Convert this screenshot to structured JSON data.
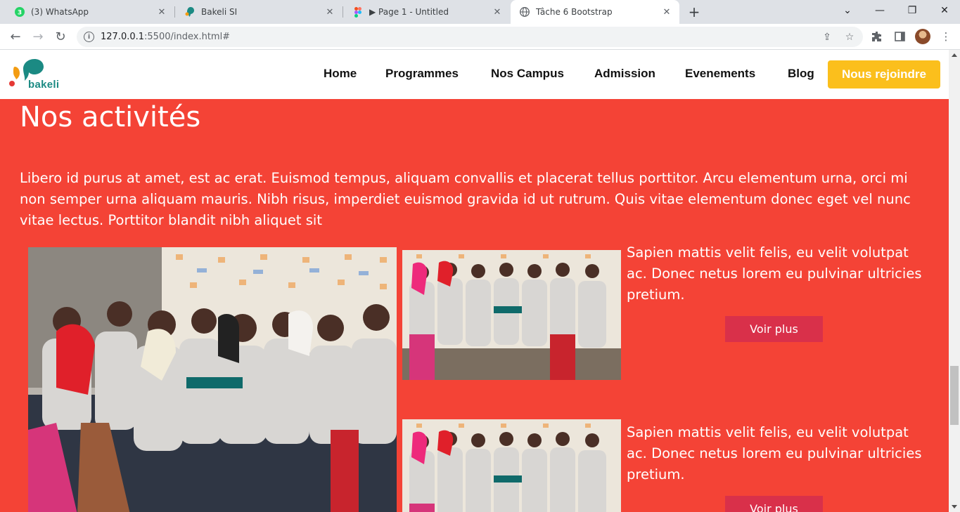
{
  "browser": {
    "tabs": [
      {
        "title": "(3) WhatsApp",
        "icon": "whatsapp-icon",
        "badge": "3"
      },
      {
        "title": "Bakeli SI",
        "icon": "bakeli-icon"
      },
      {
        "title": "▶ Page 1 - Untitled",
        "icon": "figma-icon"
      },
      {
        "title": "Tâche 6 Bootstrap",
        "icon": "globe-icon",
        "active": true
      }
    ],
    "new_tab_label": "+",
    "url_host": "127.0.0.1",
    "url_rest": ":5500/index.html#"
  },
  "site": {
    "logo_text": "bakeli",
    "nav_items": [
      "Home",
      "Programmes",
      "Nos Campus",
      "Admission",
      "Evenements",
      "Blog"
    ],
    "cta": "Nous rejoindre",
    "colors": {
      "accent": "#f44336",
      "cta": "#fbbf1c",
      "button": "#d9304a",
      "logo_teal": "#1b8a83"
    }
  },
  "activities": {
    "title": "Nos activités",
    "description": "Libero id purus at amet, est ac erat. Euismod tempus, aliquam convallis et placerat tellus porttitor. Arcu elementum urna, orci mi non semper urna aliquam mauris. Nibh risus, imperdiet euismod gravida id ut rutrum. Quis vitae elementum donec eget vel nunc vitae lectus. Porttitor blandit nibh aliquet sit",
    "cards": [
      {
        "text": "Sapien mattis velit felis, eu velit volutpat ac. Donec netus lorem eu pulvinar ultricies pretium.",
        "button": "Voir plus"
      },
      {
        "text": "Sapien mattis velit felis, eu velit volutpat ac. Donec netus lorem eu pulvinar ultricies pretium.",
        "button": "Voir plus"
      }
    ]
  }
}
